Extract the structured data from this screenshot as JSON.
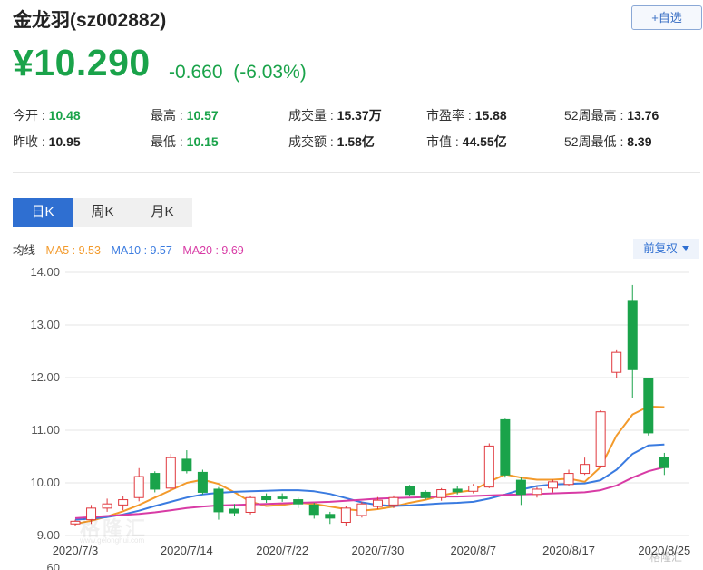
{
  "stock": {
    "name": "金龙羽(sz002882)",
    "add_label": "+自选",
    "price": "¥10.290",
    "change": "-0.660",
    "change_pct": "(-6.03%)",
    "color_down": "#1aa34a",
    "color_up": "#e0393e"
  },
  "stats": [
    [
      {
        "label": "今开",
        "value": "10.48",
        "tone": "green"
      },
      {
        "label": "最高",
        "value": "10.57",
        "tone": "green"
      },
      {
        "label": "成交量",
        "value": "15.37万",
        "tone": "dark"
      },
      {
        "label": "市盈率",
        "value": "15.88",
        "tone": "dark"
      },
      {
        "label": "52周最高",
        "value": "13.76",
        "tone": "dark"
      }
    ],
    [
      {
        "label": "昨收",
        "value": "10.95",
        "tone": "dark"
      },
      {
        "label": "最低",
        "value": "10.15",
        "tone": "green"
      },
      {
        "label": "成交额",
        "value": "1.58亿",
        "tone": "dark"
      },
      {
        "label": "市值",
        "value": "44.55亿",
        "tone": "dark"
      },
      {
        "label": "52周最低",
        "value": "8.39",
        "tone": "dark"
      }
    ]
  ],
  "tabs": [
    "日K",
    "周K",
    "月K"
  ],
  "active_tab": 0,
  "legend": {
    "title": "均线",
    "ma5": "MA5 : 9.53",
    "ma10": "MA10 : 9.57",
    "ma20": "MA20 : 9.69",
    "ma5_color": "#f39a2b",
    "ma10_color": "#3a7be0",
    "ma20_color": "#d83ba5"
  },
  "adjust_label": "前复权",
  "watermark": {
    "text": "格隆汇",
    "sub": "www.gelonghui.com",
    "badge": "格隆汇"
  },
  "chart_data": {
    "type": "candlestick",
    "ylim": [
      9.0,
      14.0
    ],
    "y_ticks": [
      "14.00",
      "13.00",
      "12.00",
      "11.00",
      "10.00",
      "9.00"
    ],
    "y_cut_label": "60",
    "x_tick_labels": [
      {
        "index": 0,
        "label": "2020/7/3"
      },
      {
        "index": 7,
        "label": "2020/7/14"
      },
      {
        "index": 13,
        "label": "2020/7/22"
      },
      {
        "index": 19,
        "label": "2020/7/30"
      },
      {
        "index": 25,
        "label": "2020/8/7"
      },
      {
        "index": 31,
        "label": "2020/8/17"
      },
      {
        "index": 37,
        "label": "2020/8/25"
      }
    ],
    "candles": [
      {
        "o": 9.22,
        "c": 9.27,
        "h": 9.3,
        "l": 9.18
      },
      {
        "o": 9.3,
        "c": 9.52,
        "h": 9.58,
        "l": 9.22
      },
      {
        "o": 9.52,
        "c": 9.6,
        "h": 9.7,
        "l": 9.45
      },
      {
        "o": 9.58,
        "c": 9.68,
        "h": 9.75,
        "l": 9.48
      },
      {
        "o": 9.72,
        "c": 10.12,
        "h": 10.28,
        "l": 9.65
      },
      {
        "o": 10.18,
        "c": 9.88,
        "h": 10.22,
        "l": 9.82
      },
      {
        "o": 9.9,
        "c": 10.48,
        "h": 10.55,
        "l": 9.86
      },
      {
        "o": 10.45,
        "c": 10.23,
        "h": 10.62,
        "l": 10.18
      },
      {
        "o": 10.2,
        "c": 9.82,
        "h": 10.25,
        "l": 9.78
      },
      {
        "o": 9.88,
        "c": 9.45,
        "h": 9.92,
        "l": 9.3
      },
      {
        "o": 9.5,
        "c": 9.43,
        "h": 9.6,
        "l": 9.38
      },
      {
        "o": 9.44,
        "c": 9.72,
        "h": 9.76,
        "l": 9.4
      },
      {
        "o": 9.74,
        "c": 9.68,
        "h": 9.8,
        "l": 9.62
      },
      {
        "o": 9.73,
        "c": 9.7,
        "h": 9.8,
        "l": 9.64
      },
      {
        "o": 9.68,
        "c": 9.6,
        "h": 9.72,
        "l": 9.52
      },
      {
        "o": 9.58,
        "c": 9.4,
        "h": 9.62,
        "l": 9.32
      },
      {
        "o": 9.4,
        "c": 9.33,
        "h": 9.45,
        "l": 9.22
      },
      {
        "o": 9.25,
        "c": 9.52,
        "h": 9.56,
        "l": 9.18
      },
      {
        "o": 9.38,
        "c": 9.6,
        "h": 9.64,
        "l": 9.34
      },
      {
        "o": 9.55,
        "c": 9.67,
        "h": 9.73,
        "l": 9.5
      },
      {
        "o": 9.58,
        "c": 9.72,
        "h": 9.76,
        "l": 9.52
      },
      {
        "o": 9.93,
        "c": 9.78,
        "h": 9.96,
        "l": 9.74
      },
      {
        "o": 9.82,
        "c": 9.72,
        "h": 9.86,
        "l": 9.68
      },
      {
        "o": 9.72,
        "c": 9.87,
        "h": 9.9,
        "l": 9.66
      },
      {
        "o": 9.88,
        "c": 9.83,
        "h": 9.94,
        "l": 9.78
      },
      {
        "o": 9.84,
        "c": 9.94,
        "h": 9.98,
        "l": 9.8
      },
      {
        "o": 9.92,
        "c": 10.7,
        "h": 10.75,
        "l": 9.9
      },
      {
        "o": 11.2,
        "c": 10.15,
        "h": 11.22,
        "l": 10.1
      },
      {
        "o": 10.05,
        "c": 9.78,
        "h": 10.1,
        "l": 9.58
      },
      {
        "o": 9.78,
        "c": 9.88,
        "h": 9.92,
        "l": 9.72
      },
      {
        "o": 9.9,
        "c": 10.02,
        "h": 10.06,
        "l": 9.82
      },
      {
        "o": 9.97,
        "c": 10.18,
        "h": 10.25,
        "l": 9.94
      },
      {
        "o": 10.18,
        "c": 10.35,
        "h": 10.48,
        "l": 10.15
      },
      {
        "o": 10.32,
        "c": 11.35,
        "h": 11.38,
        "l": 10.28
      },
      {
        "o": 12.1,
        "c": 12.48,
        "h": 12.52,
        "l": 12.0
      },
      {
        "o": 13.45,
        "c": 12.15,
        "h": 13.76,
        "l": 11.62
      },
      {
        "o": 11.98,
        "c": 10.95,
        "h": 11.98,
        "l": 10.9
      },
      {
        "o": 10.48,
        "c": 10.29,
        "h": 10.57,
        "l": 10.15
      }
    ],
    "series": [
      {
        "name": "MA5",
        "values": [
          9.22,
          9.28,
          9.36,
          9.46,
          9.58,
          9.72,
          9.86,
          10.0,
          10.06,
          9.98,
          9.82,
          9.64,
          9.56,
          9.58,
          9.62,
          9.6,
          9.55,
          9.5,
          9.47,
          9.5,
          9.55,
          9.62,
          9.68,
          9.76,
          9.82,
          9.86,
          10.02,
          10.16,
          10.1,
          10.06,
          10.06,
          10.08,
          10.02,
          10.3,
          10.9,
          11.3,
          11.45,
          11.44
        ]
      },
      {
        "name": "MA10",
        "values": [
          9.3,
          9.32,
          9.35,
          9.4,
          9.47,
          9.56,
          9.64,
          9.72,
          9.78,
          9.81,
          9.83,
          9.84,
          9.85,
          9.86,
          9.86,
          9.84,
          9.79,
          9.71,
          9.63,
          9.58,
          9.56,
          9.57,
          9.59,
          9.61,
          9.62,
          9.64,
          9.7,
          9.78,
          9.87,
          9.94,
          9.97,
          9.98,
          9.99,
          10.05,
          10.25,
          10.55,
          10.71,
          10.73
        ]
      },
      {
        "name": "MA20",
        "values": [
          9.33,
          9.35,
          9.37,
          9.39,
          9.41,
          9.44,
          9.48,
          9.52,
          9.55,
          9.57,
          9.58,
          9.59,
          9.6,
          9.61,
          9.62,
          9.63,
          9.64,
          9.66,
          9.68,
          9.7,
          9.71,
          9.72,
          9.73,
          9.74,
          9.74,
          9.75,
          9.76,
          9.77,
          9.78,
          9.79,
          9.8,
          9.81,
          9.82,
          9.86,
          9.95,
          10.1,
          10.22,
          10.3
        ]
      }
    ]
  }
}
